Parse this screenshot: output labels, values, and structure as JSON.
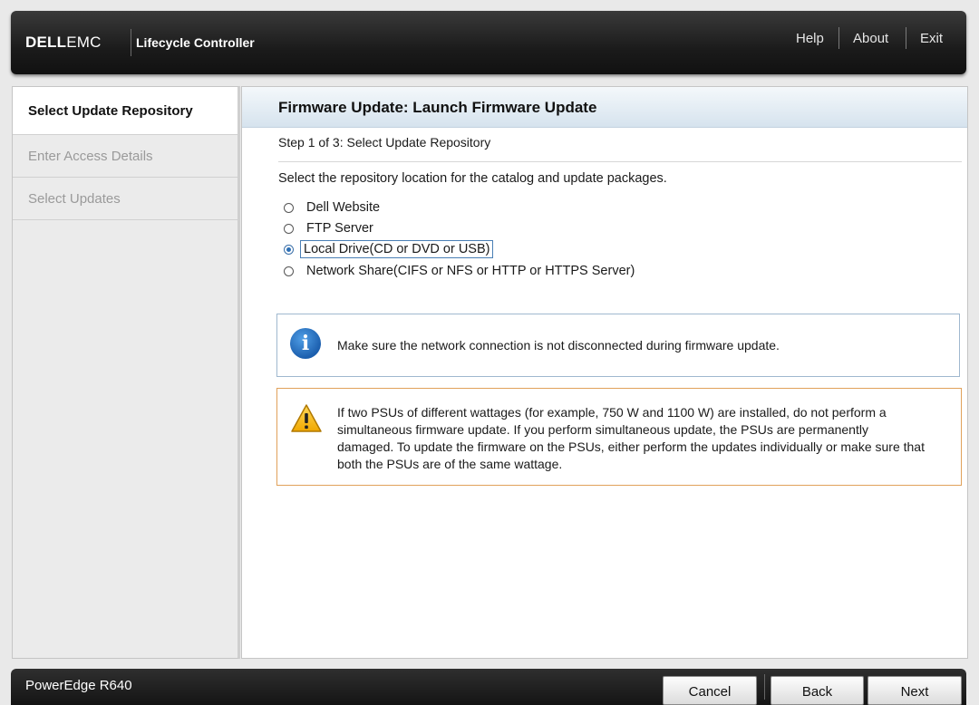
{
  "header": {
    "logo_dell": "DELL",
    "logo_emc": "EMC",
    "app_title": "Lifecycle Controller",
    "links": {
      "help": "Help",
      "about": "About",
      "exit": "Exit"
    }
  },
  "sidebar": {
    "items": [
      {
        "label": "Select Update Repository",
        "state": "active"
      },
      {
        "label": "Enter Access Details",
        "state": "disabled"
      },
      {
        "label": "Select Updates",
        "state": "disabled"
      }
    ]
  },
  "main": {
    "title": "Firmware Update: Launch Firmware Update",
    "step": "Step 1 of 3: Select Update Repository",
    "instruction": "Select the repository location for the catalog and update packages.",
    "options": [
      {
        "label": "Dell Website",
        "checked": false
      },
      {
        "label": "FTP Server",
        "checked": false
      },
      {
        "label": "Local Drive(CD or DVD or USB)",
        "checked": true
      },
      {
        "label": "Network Share(CIFS or NFS or HTTP or HTTPS Server)",
        "checked": false
      }
    ],
    "info": {
      "icon": "info-icon",
      "text": "Make sure the network connection is not disconnected during firmware update."
    },
    "warning": {
      "icon": "warning-icon",
      "text": "If two PSUs of different wattages (for example, 750 W and 1100 W) are installed, do not perform a simultaneous firmware update. If you perform simultaneous update, the PSUs are permanently damaged. To update the firmware on the PSUs, either perform the updates individually or make sure that both the PSUs are of the same wattage."
    }
  },
  "footer": {
    "model": "PowerEdge R640",
    "cancel_label": "Cancel",
    "back_label": "Back",
    "next_label": "Next"
  },
  "colors": {
    "accent": "#2c6fb5",
    "warning_border": "#e0a15a",
    "info_border": "#9fb8cf"
  }
}
